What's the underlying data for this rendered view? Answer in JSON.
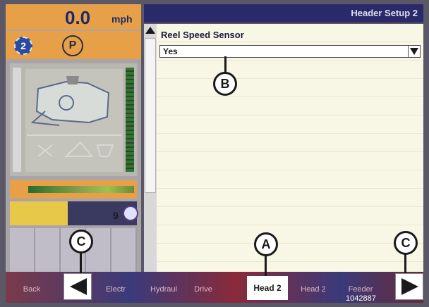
{
  "status": {
    "speed_value": "0.0",
    "speed_unit": "mph",
    "gear": "2",
    "park": "P",
    "control_badge": "9"
  },
  "header": {
    "title": "Header Setup 2"
  },
  "setting": {
    "label": "Reel Speed Sensor",
    "value": "Yes"
  },
  "callouts": {
    "a": "A",
    "b": "B",
    "c_left": "C",
    "c_right": "C"
  },
  "tabs": [
    {
      "label": "Back"
    },
    {
      "label": "Electr"
    },
    {
      "label": "Hydraul"
    },
    {
      "label": "Drive"
    },
    {
      "label": "Head 2"
    },
    {
      "label": "Head 2"
    },
    {
      "label": "Feeder"
    }
  ],
  "active_tab_index": 4,
  "figure_id": "1042887",
  "colors": {
    "accent": "#e8a048",
    "title_bar": "#2a2a6a",
    "content_bg": "#f8f6e4"
  }
}
